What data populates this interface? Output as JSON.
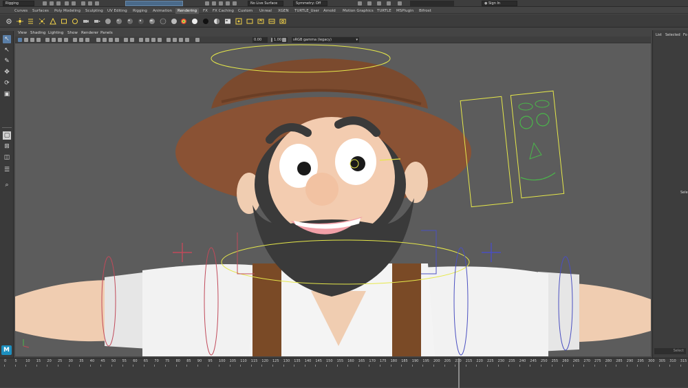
{
  "topbar": {
    "menuset": "Rigging",
    "live_surface": "No Live Surface",
    "symmetry": "Symmetry: Off",
    "sign_in": "Sign In"
  },
  "shelf_tabs": [
    "Curves",
    "Surfaces",
    "Poly Modeling",
    "Sculpting",
    "UV Editing",
    "Rigging",
    "Animation",
    "Rendering",
    "FX",
    "FX Caching",
    "Custom",
    "Unreal",
    "XGEN",
    "TURTLE_User",
    "Arnold",
    "Motion Graphics",
    "TURTLE",
    "MSPlugin",
    "Bifrost"
  ],
  "active_shelf": "Rendering",
  "panel_menu": [
    "View",
    "Shading",
    "Lighting",
    "Show",
    "Renderer",
    "Panels"
  ],
  "panel_toolbar": {
    "near_value": "0.00",
    "far_value": "1.00",
    "color_space": "sRGB gamma (legacy)"
  },
  "right_panel": {
    "tabs": [
      "List",
      "Selected",
      "Fo"
    ],
    "side_label": "Select"
  },
  "timeline": {
    "ticks": [
      "0",
      "5",
      "10",
      "15",
      "20",
      "25",
      "30",
      "35",
      "40",
      "45",
      "50",
      "55",
      "60",
      "65",
      "70",
      "75",
      "80",
      "85",
      "90",
      "95",
      "100",
      "105",
      "110",
      "115",
      "120",
      "125",
      "130",
      "135",
      "140",
      "145",
      "150",
      "155",
      "160",
      "165",
      "170",
      "175",
      "180",
      "185",
      "190",
      "195",
      "200",
      "205",
      "210",
      "215",
      "220",
      "225",
      "230",
      "235",
      "240",
      "245",
      "250",
      "255",
      "260",
      "265",
      "270",
      "275",
      "280",
      "285",
      "290",
      "295",
      "300",
      "305",
      "310",
      "315"
    ]
  },
  "logo": "M",
  "colors": {
    "viewport_bg": "#5c5c5c",
    "hat": "#8a5234",
    "skin": "#f3ccb0",
    "beard": "#3a3a3a",
    "shirt": "#e8e8e8",
    "suspenders": "#7a4a26",
    "controller_yellow": "#e6e84a",
    "controller_red": "#c14a5a",
    "controller_blue": "#4a4fc1",
    "accent_blue": "#1c8fbf"
  }
}
